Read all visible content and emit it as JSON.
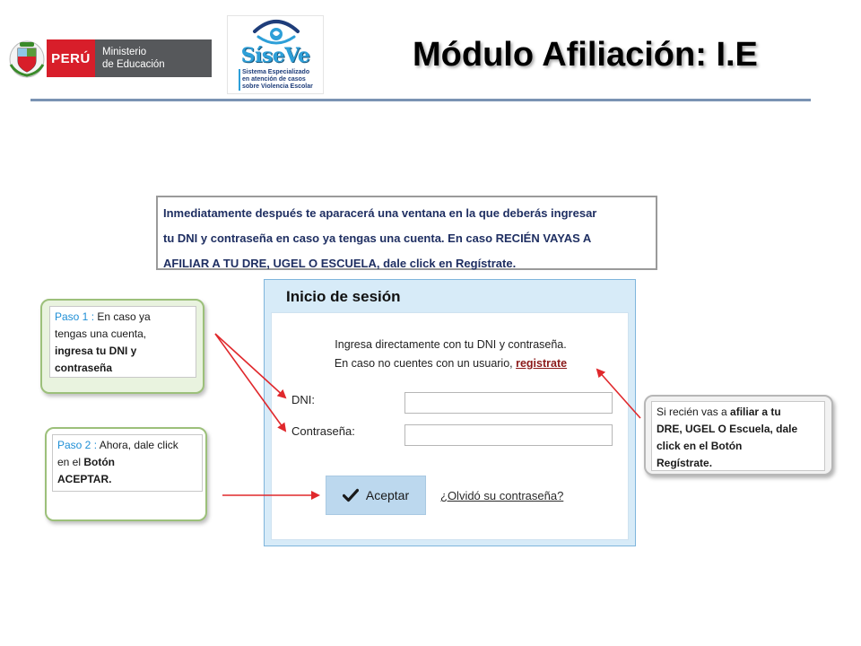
{
  "header": {
    "peru_label": "PERÚ",
    "ministerio_line1": "Ministerio",
    "ministerio_line2": "de Educación",
    "siseve_name": "SíseVe",
    "siseve_sub_1": "Sistema Especializado",
    "siseve_sub_2": "en atención de casos",
    "siseve_sub_3": "sobre Violencia Escolar",
    "title": "Módulo Afiliación: I.E"
  },
  "instructions": {
    "line1": "Inmediatamente después te aparacerá una ventana en la que deberás ingresar",
    "line2": "tu DNI y contraseña en caso ya tengas una cuenta. En caso RECIÉN VAYAS A",
    "line3": "AFILIAR A TU DRE, UGEL O ESCUELA, dale click en Regístrate."
  },
  "login": {
    "title": "Inicio de sesión",
    "intro1": "Ingresa directamente con tu DNI y contraseña.",
    "intro2_prefix": "En caso no cuentes con un usuario, ",
    "register_link": "registrate",
    "dni_label": "DNI:",
    "password_label": "Contraseña:",
    "dni_value": "",
    "password_value": "",
    "accept_label": "Aceptar",
    "forgot_link": "¿Olvidó su contraseña?"
  },
  "step1": {
    "step_label": "Paso 1 :",
    "t1": " En caso ya",
    "t2": "tengas una cuenta,",
    "t3": "ingresa tu DNI y",
    "t4": "contraseña"
  },
  "step2": {
    "step_label": "Paso 2 :",
    "t1": " Ahora, dale click",
    "t2_plain": "en el ",
    "t2_bold": "Botón",
    "t3": "ACEPTAR."
  },
  "step3": {
    "t1_plain": "Si recién vas a ",
    "t1_bold": "afiliar a tu",
    "t2": "DRE, UGEL O Escuela, dale",
    "t3": "click en el Botón",
    "t4": "Regístrate."
  },
  "colors": {
    "peru_red": "#d81e2a",
    "siseve_blue": "#2d9fd8",
    "instruction_text": "#1f2f62",
    "step_label_blue": "#1f8fd6",
    "arrow_red": "#e0282c",
    "login_frame": "#d7ebf8"
  }
}
